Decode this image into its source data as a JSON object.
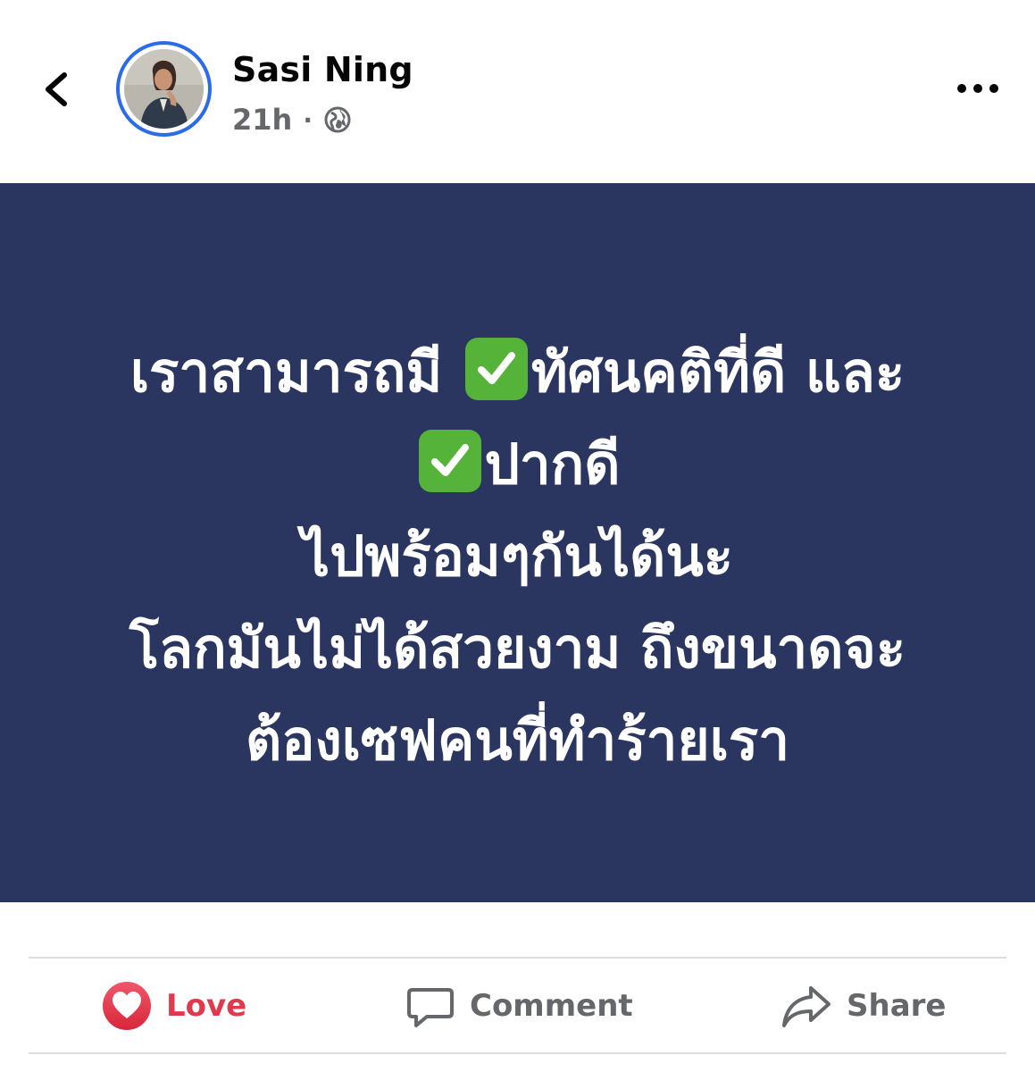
{
  "header": {
    "author_name": "Sasi Ning",
    "timestamp": "21h",
    "separator": "·",
    "privacy_icon": "globe-icon",
    "back_icon": "chevron-left-icon",
    "more_icon": "more-horizontal-icon"
  },
  "post": {
    "background_color": "#2a365f",
    "lines": [
      {
        "before": "เราสามารถมี ",
        "emoji": "check-mark-button-icon",
        "after": "ทัศนคติที่ดี และ"
      },
      {
        "before": "",
        "emoji": "check-mark-button-icon",
        "after": "ปากดี"
      },
      {
        "text": "ไปพร้อมๆกันได้นะ"
      },
      {
        "text": "โลกมันไม่ได้สวยงาม ถึงขนาดจะ"
      },
      {
        "text": "ต้องเซฟคนที่ทำร้ายเรา"
      }
    ]
  },
  "actions": {
    "love": {
      "label": "Love",
      "icon": "heart-icon",
      "color": "#e0394c"
    },
    "comment": {
      "label": "Comment",
      "icon": "comment-bubble-icon"
    },
    "share": {
      "label": "Share",
      "icon": "share-arrow-icon"
    }
  }
}
